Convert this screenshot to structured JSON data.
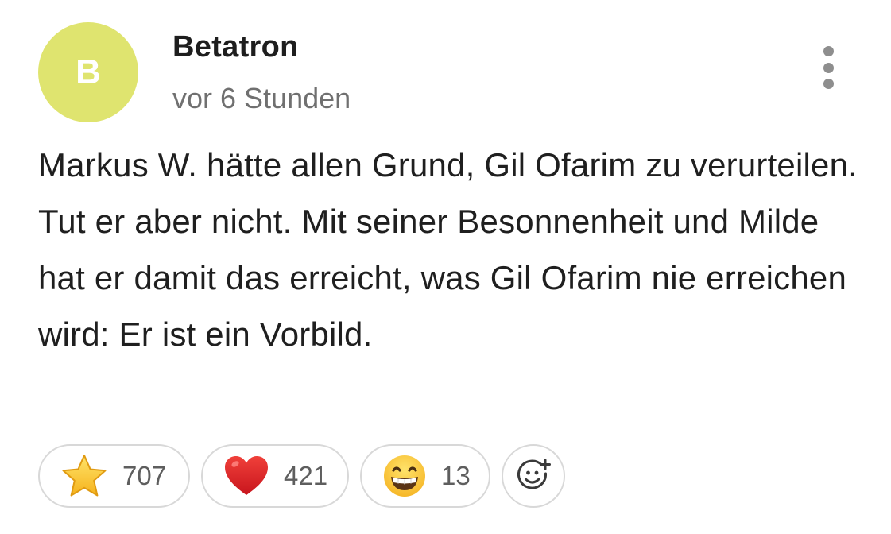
{
  "comment": {
    "author": {
      "initial": "B",
      "name": "Betatron",
      "avatar_color": "#dfe46f"
    },
    "timestamp": "vor 6 Stunden",
    "body": "Markus W. hätte allen Grund, Gil Ofarim zu verurteilen. Tut er aber nicht. Mit seiner Besonnenheit und Milde hat er damit das erreicht, was Gil Ofarim nie erreichen wird: Er ist ein Vorbild.",
    "menu_icon": "more-vertical-icon"
  },
  "reactions": [
    {
      "icon": "star-icon",
      "count": "707"
    },
    {
      "icon": "heart-icon",
      "count": "421"
    },
    {
      "icon": "grinning-face-icon",
      "count": "13"
    }
  ],
  "add_reaction": {
    "icon": "add-reaction-icon"
  },
  "colors": {
    "pill_border": "#d8d8d8",
    "timestamp": "#707070",
    "text": "#1f1f1f"
  }
}
